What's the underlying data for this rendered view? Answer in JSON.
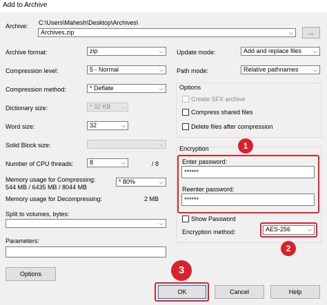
{
  "window": {
    "title": "Add to Archive"
  },
  "archive": {
    "label": "Archive:",
    "path": "C:\\Users\\Mahesh\\Desktop\\Archives\\",
    "filename": "Archives.zip",
    "browse_label": "..."
  },
  "left": {
    "archive_format": {
      "label": "Archive format:",
      "value": "zip"
    },
    "compression_level": {
      "label": "Compression level:",
      "value": "5 - Normal"
    },
    "compression_method": {
      "label": "Compression method:",
      "value": "* Deflate"
    },
    "dictionary_size": {
      "label": "Dictionary size:",
      "value": "* 32 KB"
    },
    "word_size": {
      "label": "Word size:",
      "value": "32"
    },
    "solid_block_size": {
      "label": "Solid Block size:",
      "value": ""
    },
    "cpu_threads": {
      "label": "Number of CPU threads:",
      "value": "8",
      "max": "/ 8"
    },
    "memory_compress": {
      "label": "Memory usage for Compressing:",
      "value": "544 MB / 6435 MB / 8044 MB",
      "option": "* 80%"
    },
    "memory_decompress": {
      "label": "Memory usage for Decompressing:",
      "value": "2 MB"
    },
    "split": {
      "label": "Split to volumes, bytes:",
      "value": ""
    },
    "parameters": {
      "label": "Parameters:",
      "value": ""
    },
    "options_button": "Options"
  },
  "right": {
    "update_mode": {
      "label": "Update mode:",
      "value": "Add and replace files"
    },
    "path_mode": {
      "label": "Path mode:",
      "value": "Relative pathnames"
    },
    "options": {
      "title": "Options",
      "sfx": "Create SFX archive",
      "compress_shared": "Compress shared files",
      "delete_after": "Delete files after compression"
    },
    "encryption": {
      "title": "Encryption",
      "enter_label": "Enter password:",
      "enter_value": "******",
      "reenter_label": "Reenter password:",
      "reenter_value": "******",
      "show_password": "Show Password",
      "method_label": "Encryption method:",
      "method_value": "AES-256"
    }
  },
  "buttons": {
    "ok": "OK",
    "cancel": "Cancel",
    "help": "Help"
  },
  "callouts": [
    "1",
    "2",
    "3"
  ],
  "colors": {
    "highlight": "#d9212a"
  }
}
